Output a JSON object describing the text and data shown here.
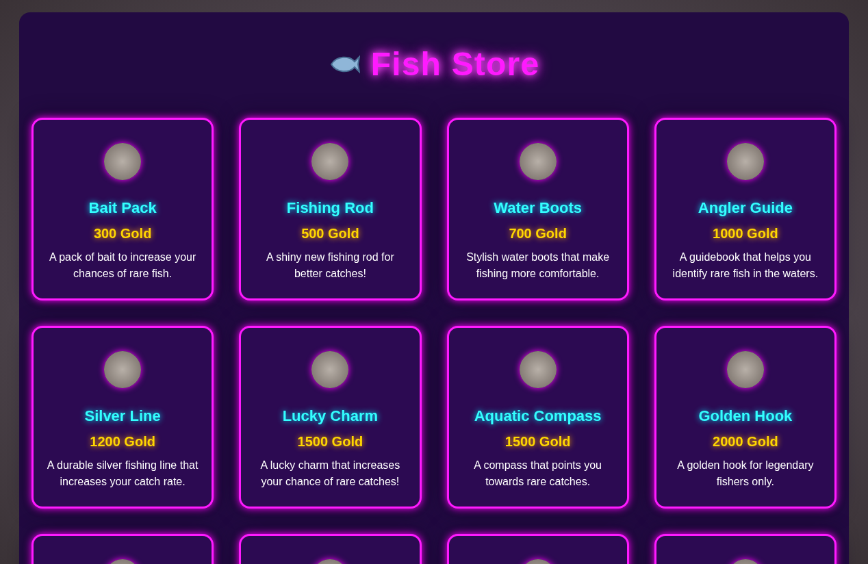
{
  "title": "Fish Store",
  "items": [
    {
      "kind": "full",
      "name": "Bait Pack",
      "price": "300 Gold",
      "description": "A pack of bait to increase your chances of rare fish."
    },
    {
      "kind": "full",
      "name": "Fishing Rod",
      "price": "500 Gold",
      "description": "A shiny new fishing rod for better catches!"
    },
    {
      "kind": "full",
      "name": "Water Boots",
      "price": "700 Gold",
      "description": "Stylish water boots that make fishing more comfortable."
    },
    {
      "kind": "full",
      "name": "Angler Guide",
      "price": "1000 Gold",
      "description": "A guidebook that helps you identify rare fish in the waters."
    },
    {
      "kind": "full",
      "name": "Silver Line",
      "price": "1200 Gold",
      "description": "A durable silver fishing line that increases your catch rate."
    },
    {
      "kind": "full",
      "name": "Lucky Charm",
      "price": "1500 Gold",
      "description": "A lucky charm that increases your chance of rare catches!"
    },
    {
      "kind": "full",
      "name": "Aquatic Compass",
      "price": "1500 Gold",
      "description": "A compass that points you towards rare catches."
    },
    {
      "kind": "full",
      "name": "Golden Hook",
      "price": "2000 Gold",
      "description": "A golden hook for legendary fishers only."
    },
    {
      "kind": "partial"
    },
    {
      "kind": "partial"
    },
    {
      "kind": "partial"
    },
    {
      "kind": "partial"
    }
  ]
}
